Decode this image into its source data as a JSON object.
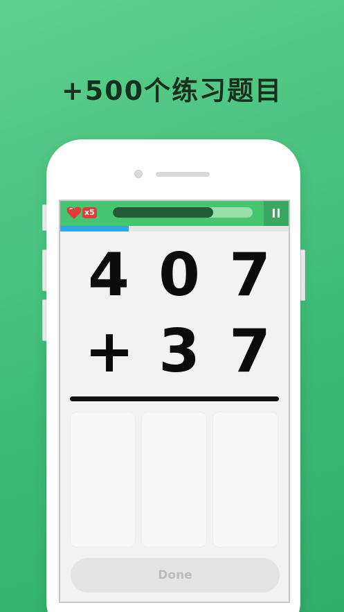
{
  "headline": "+500个练习题目",
  "status_bar": {
    "lives_label": "x5",
    "progress": 0.72,
    "timer_progress": 0.3,
    "icons": [
      "heart-icon",
      "pause-icon"
    ]
  },
  "problem": {
    "top_digits": [
      "4",
      "0",
      "7"
    ],
    "operator": "+",
    "bottom_digits": [
      "3",
      "7"
    ]
  },
  "answer_slots": [
    "",
    "",
    ""
  ],
  "done_label": "Done",
  "colors": {
    "background": "#3fbd76",
    "topbar": "#45c56f",
    "progress_fill": "#1f5c36",
    "timer": "#2ea7e8",
    "heart": "#e23b3b"
  }
}
